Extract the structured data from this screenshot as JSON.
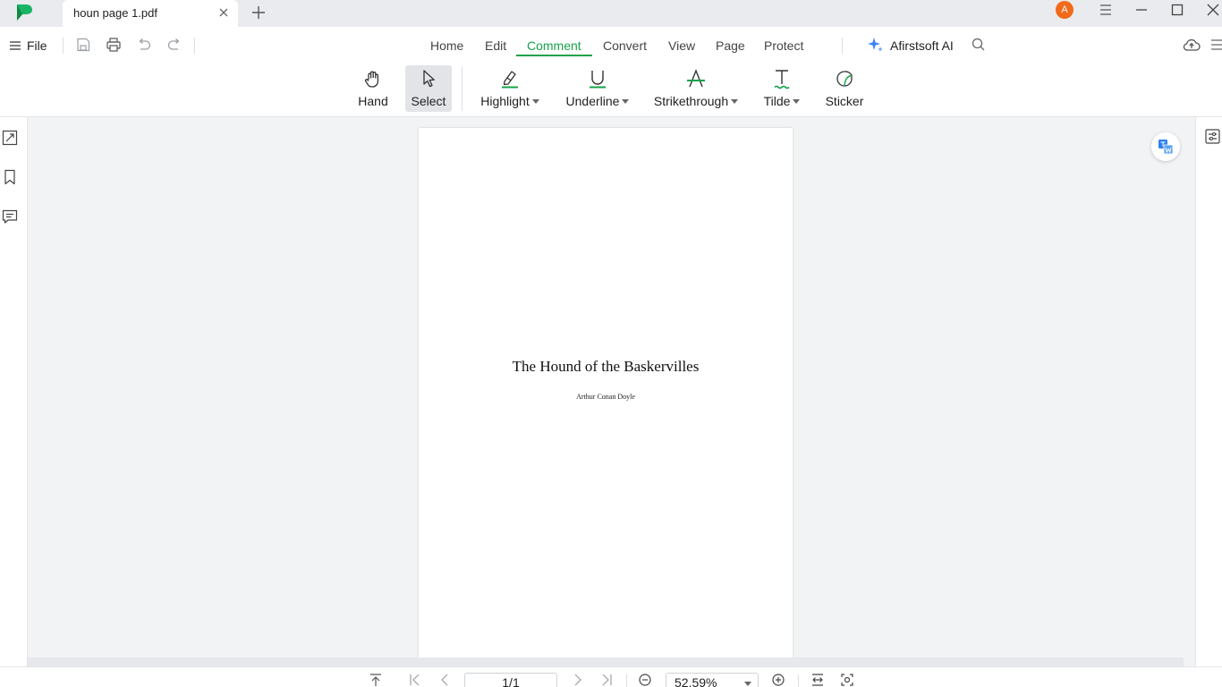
{
  "titlebar": {
    "tab_title": "houn page 1.pdf",
    "avatar_initial": "A"
  },
  "menu": {
    "file_label": "File",
    "tabs": [
      {
        "label": "Home",
        "active": false
      },
      {
        "label": "Edit",
        "active": false
      },
      {
        "label": "Comment",
        "active": true
      },
      {
        "label": "Convert",
        "active": false
      },
      {
        "label": "View",
        "active": false
      },
      {
        "label": "Page",
        "active": false
      },
      {
        "label": "Protect",
        "active": false
      }
    ],
    "ai_label": "Afirstsoft AI"
  },
  "ribbon": {
    "items": [
      {
        "label": "Hand",
        "icon": "hand-icon",
        "dropdown": false,
        "selected": false
      },
      {
        "label": "Select",
        "icon": "cursor-icon",
        "dropdown": false,
        "selected": true
      },
      {
        "label": "Highlight",
        "icon": "highlight-icon",
        "dropdown": true,
        "selected": false
      },
      {
        "label": "Underline",
        "icon": "underline-icon",
        "dropdown": true,
        "selected": false
      },
      {
        "label": "Strikethrough",
        "icon": "strikethrough-icon",
        "dropdown": true,
        "selected": false
      },
      {
        "label": "Tilde",
        "icon": "tilde-icon",
        "dropdown": true,
        "selected": false
      },
      {
        "label": "Sticker",
        "icon": "sticker-icon",
        "dropdown": false,
        "selected": false
      }
    ]
  },
  "document": {
    "title": "The Hound of the Baskervilles",
    "author": "Arthur Conan Doyle"
  },
  "statusbar": {
    "page_indicator": "1/1",
    "zoom": "52.59%"
  },
  "colors": {
    "accent": "#16a34a",
    "avatar": "#f26a1b",
    "workspace": "#f2f3f5"
  }
}
